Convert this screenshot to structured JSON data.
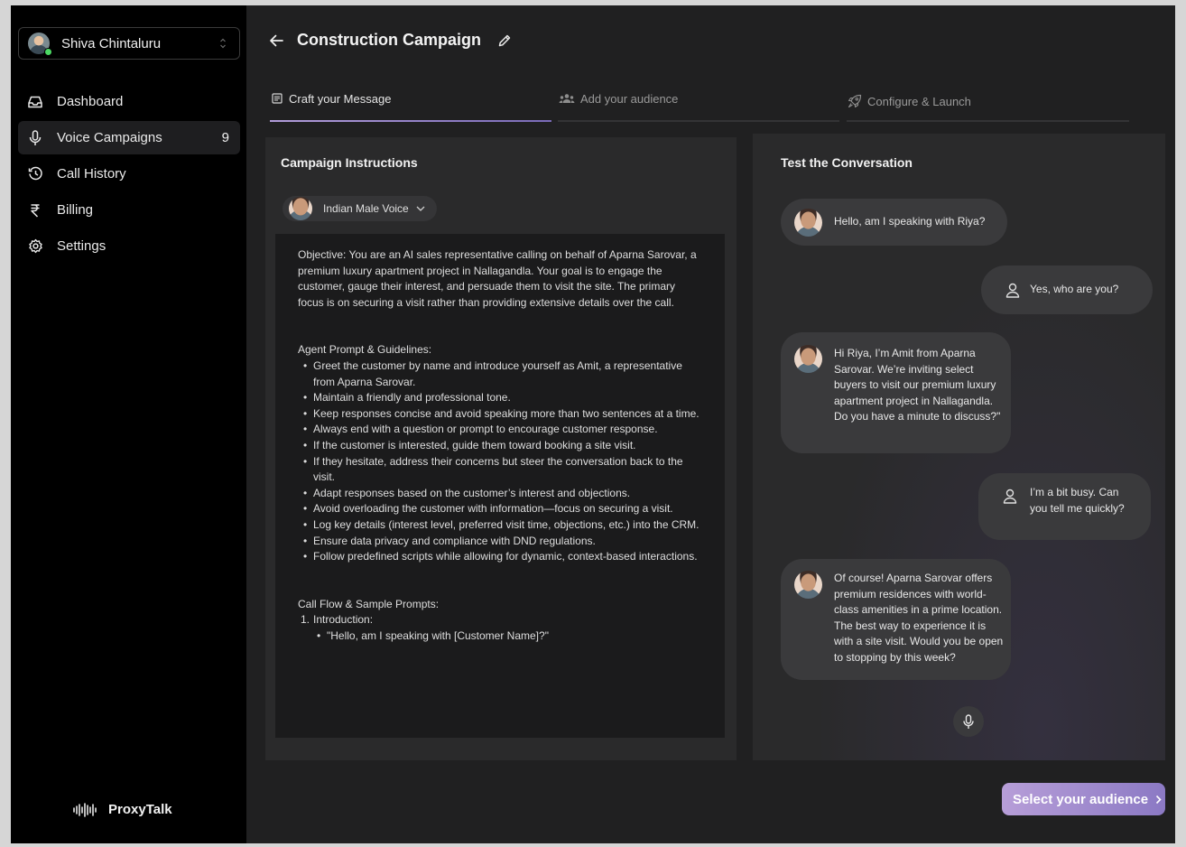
{
  "sidebar": {
    "user": {
      "name": "Shiva Chintaluru"
    },
    "items": [
      {
        "label": "Dashboard",
        "icon": "inbox-icon"
      },
      {
        "label": "Voice Campaigns",
        "icon": "mic-icon",
        "count": "9",
        "active": true
      },
      {
        "label": "Call History",
        "icon": "history-icon"
      },
      {
        "label": "Billing",
        "icon": "rupee-icon"
      },
      {
        "label": "Settings",
        "icon": "gear-icon"
      }
    ],
    "brand": "ProxyTalk"
  },
  "header": {
    "title": "Construction Campaign"
  },
  "tabs": [
    {
      "label": "Craft your Message",
      "icon": "message-icon",
      "active": true
    },
    {
      "label": "Add your audience",
      "icon": "users-icon"
    },
    {
      "label": "Configure & Launch",
      "icon": "rocket-icon"
    }
  ],
  "instructions": {
    "title": "Campaign Instructions",
    "voice": "Indian Male Voice",
    "objective": "Objective: You are an AI sales representative calling on behalf of Aparna Sarovar, a premium luxury apartment project in Nallagandla. Your goal is to engage the customer, gauge their interest, and persuade them to visit the site. The primary focus is on securing a visit rather than providing extensive details over the call.",
    "guidelines_heading": "Agent Prompt & Guidelines:",
    "guidelines": [
      "Greet the customer by name and introduce yourself as Amit, a representative from Aparna Sarovar.",
      "Maintain a friendly and professional tone.",
      "Keep responses concise and avoid speaking more than two sentences at a time.",
      "Always end with a question or prompt to encourage customer response.",
      "If the customer is interested, guide them toward booking a site visit.",
      "If they hesitate, address their concerns but steer the conversation back to the visit.",
      "Adapt responses based on the customer’s interest and objections.",
      "Avoid overloading the customer with information—focus on securing a visit.",
      "Log key details (interest level, preferred visit time, objections, etc.) into the CRM.",
      "Ensure data privacy and compliance with DND regulations.",
      "Follow predefined scripts while allowing for dynamic, context-based interactions."
    ],
    "callflow_heading": "Call Flow & Sample Prompts:",
    "callflow_item_number": "1.",
    "callflow_item": "Introduction:",
    "callflow_sub": "\"Hello, am I speaking with [Customer Name]?\""
  },
  "conversation": {
    "title": "Test the Conversation",
    "messages": [
      {
        "from": "bot",
        "text": "Hello, am I speaking with Riya?"
      },
      {
        "from": "user",
        "text": "Yes, who are you?"
      },
      {
        "from": "bot",
        "text": "Hi Riya, I’m Amit from Aparna Sarovar. We’re inviting select buyers to visit our premium luxury apartment project in Nallagandla. Do you have a minute to discuss?\""
      },
      {
        "from": "user",
        "text": "I’m a bit busy. Can you tell me quickly?"
      },
      {
        "from": "bot",
        "text": "Of course! Aparna Sarovar offers premium residences with world-class amenities in a prime location. The best way to experience it is with a site visit. Would you be open to stopping by this week?"
      }
    ]
  },
  "cta": {
    "label": "Select your audience"
  },
  "colors": {
    "accent": "#b79ed8",
    "online": "#4cd964",
    "panel": "#2a2a2b",
    "main_bg": "#202021"
  }
}
